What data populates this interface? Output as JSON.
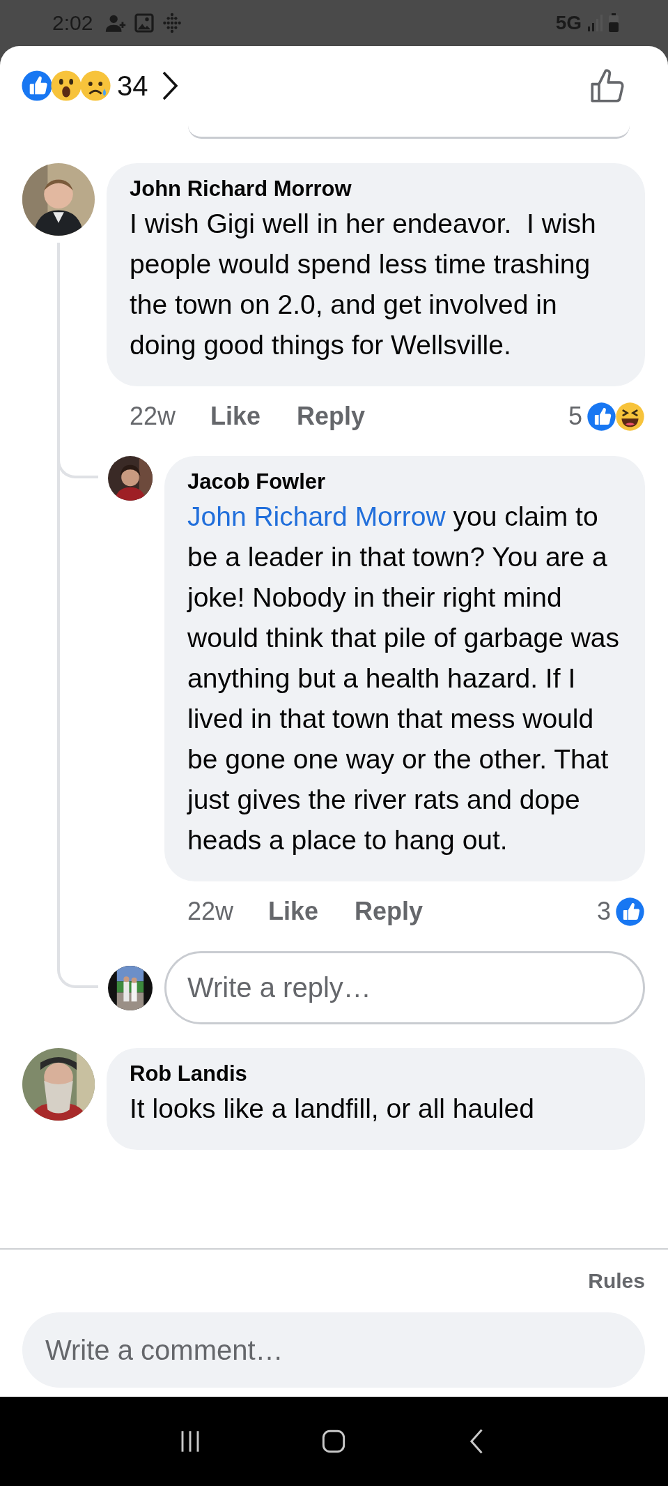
{
  "status_bar": {
    "time": "2:02",
    "network": "5G"
  },
  "reactions_bar": {
    "reactions": [
      {
        "kind": "like"
      },
      {
        "kind": "wow"
      },
      {
        "kind": "sad"
      }
    ],
    "count": "34"
  },
  "comments": [
    {
      "author": "John Richard Morrow",
      "text": "I wish Gigi well in her endeavor.  I wish people would spend less time trashing the town on 2.0, and get involved in doing good things for Wellsville.",
      "time": "22w",
      "actions": [
        "Like",
        "Reply"
      ],
      "reaction_count": "5",
      "reactions": [
        {
          "kind": "like"
        },
        {
          "kind": "haha"
        }
      ],
      "replies": [
        {
          "author": "Jacob Fowler",
          "mention": "John Richard Morrow",
          "text": "you claim to be a leader in that town? You are a joke! Nobody in their right mind would think that pile of garbage was anything but a health hazard. If I lived in that town that mess would be gone one way or the other. That just gives the river rats and dope heads a place to hang out.",
          "time": "22w",
          "actions": [
            "Like",
            "Reply"
          ],
          "reaction_count": "3",
          "reactions": [
            {
              "kind": "like"
            }
          ]
        }
      ],
      "reply_field": {
        "placeholder": "Write a reply…"
      }
    },
    {
      "author": "Rob Landis",
      "text": "It looks like a landfill, or all hauled"
    }
  ],
  "rules_link": "Rules",
  "comment_field": {
    "placeholder": "Write a comment…"
  }
}
